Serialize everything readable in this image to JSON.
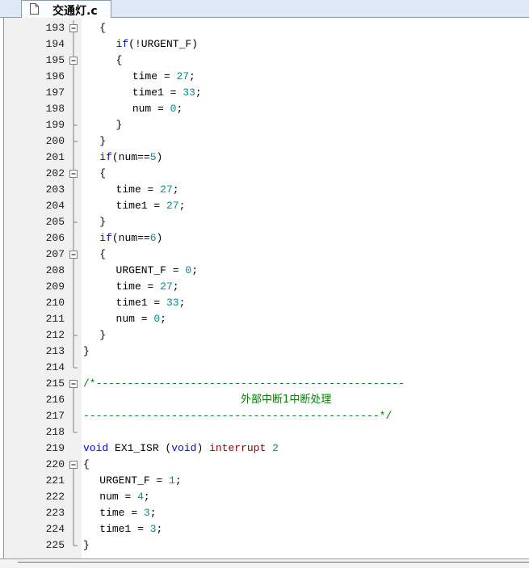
{
  "tab": {
    "label": "交通灯.c",
    "icon": "file-icon"
  },
  "lines": [
    {
      "n": "193",
      "fold": "box-cont",
      "indent": 2,
      "segs": [
        [
          "{",
          ""
        ]
      ]
    },
    {
      "n": "194",
      "fold": "line",
      "indent": 4,
      "segs": [
        [
          "if",
          "kw"
        ],
        [
          "(!URGENT_F)",
          ""
        ]
      ]
    },
    {
      "n": "195",
      "fold": "box-cont",
      "indent": 4,
      "segs": [
        [
          "{",
          ""
        ]
      ]
    },
    {
      "n": "196",
      "fold": "line",
      "indent": 6,
      "segs": [
        [
          "time = ",
          ""
        ],
        [
          "27",
          "num"
        ],
        [
          ";",
          ""
        ]
      ]
    },
    {
      "n": "197",
      "fold": "line",
      "indent": 6,
      "segs": [
        [
          "time1 = ",
          ""
        ],
        [
          "33",
          "num"
        ],
        [
          ";",
          ""
        ]
      ]
    },
    {
      "n": "198",
      "fold": "line",
      "indent": 6,
      "segs": [
        [
          "num = ",
          ""
        ],
        [
          "0",
          "num"
        ],
        [
          ";",
          ""
        ]
      ]
    },
    {
      "n": "199",
      "fold": "tee",
      "indent": 4,
      "segs": [
        [
          "}",
          ""
        ]
      ]
    },
    {
      "n": "200",
      "fold": "tee",
      "indent": 2,
      "segs": [
        [
          "}",
          ""
        ]
      ]
    },
    {
      "n": "201",
      "fold": "line",
      "indent": 2,
      "segs": [
        [
          "if",
          "kw"
        ],
        [
          "(num==",
          ""
        ],
        [
          "5",
          "num"
        ],
        [
          ")",
          ""
        ]
      ]
    },
    {
      "n": "202",
      "fold": "box-cont",
      "indent": 2,
      "segs": [
        [
          "{",
          ""
        ]
      ]
    },
    {
      "n": "203",
      "fold": "line",
      "indent": 4,
      "segs": [
        [
          "time = ",
          ""
        ],
        [
          "27",
          "num"
        ],
        [
          ";",
          ""
        ]
      ]
    },
    {
      "n": "204",
      "fold": "line",
      "indent": 4,
      "segs": [
        [
          "time1 = ",
          ""
        ],
        [
          "27",
          "num"
        ],
        [
          ";",
          ""
        ]
      ]
    },
    {
      "n": "205",
      "fold": "tee",
      "indent": 2,
      "segs": [
        [
          "}",
          ""
        ]
      ]
    },
    {
      "n": "206",
      "fold": "line",
      "indent": 2,
      "segs": [
        [
          "if",
          "kw"
        ],
        [
          "(num==",
          ""
        ],
        [
          "6",
          "num"
        ],
        [
          ")",
          ""
        ]
      ]
    },
    {
      "n": "207",
      "fold": "box-cont",
      "indent": 2,
      "segs": [
        [
          "{",
          ""
        ]
      ]
    },
    {
      "n": "208",
      "fold": "line",
      "indent": 4,
      "segs": [
        [
          "URGENT_F = ",
          ""
        ],
        [
          "0",
          "num"
        ],
        [
          ";",
          ""
        ]
      ]
    },
    {
      "n": "209",
      "fold": "line",
      "indent": 4,
      "segs": [
        [
          "time = ",
          ""
        ],
        [
          "27",
          "num"
        ],
        [
          ";",
          ""
        ]
      ]
    },
    {
      "n": "210",
      "fold": "line",
      "indent": 4,
      "segs": [
        [
          "time1 = ",
          ""
        ],
        [
          "33",
          "num"
        ],
        [
          ";",
          ""
        ]
      ]
    },
    {
      "n": "211",
      "fold": "line",
      "indent": 4,
      "segs": [
        [
          "num = ",
          ""
        ],
        [
          "0",
          "num"
        ],
        [
          ";",
          ""
        ]
      ]
    },
    {
      "n": "212",
      "fold": "tee",
      "indent": 2,
      "segs": [
        [
          "}",
          ""
        ]
      ]
    },
    {
      "n": "213",
      "fold": "line",
      "indent": 0,
      "segs": [
        [
          "}",
          ""
        ]
      ]
    },
    {
      "n": "214",
      "fold": "end",
      "indent": 0,
      "segs": []
    },
    {
      "n": "215",
      "fold": "box",
      "indent": 0,
      "segs": [
        [
          "/*-------------------------------------------------",
          "cmt"
        ]
      ]
    },
    {
      "n": "216",
      "fold": "line",
      "indent": 0,
      "segs": [
        [
          "                         ",
          ""
        ],
        [
          "外部中断1中断处理",
          "cjk"
        ]
      ]
    },
    {
      "n": "217",
      "fold": "line",
      "indent": 0,
      "segs": [
        [
          "-----------------------------------------------*/",
          "cmt"
        ]
      ]
    },
    {
      "n": "218",
      "fold": "end",
      "indent": 0,
      "segs": []
    },
    {
      "n": "219",
      "fold": "none",
      "indent": 0,
      "segs": [
        [
          "void",
          "kw"
        ],
        [
          " EX1_ISR (",
          ""
        ],
        [
          "void",
          "kw"
        ],
        [
          ") ",
          ""
        ],
        [
          "interrupt",
          "isr"
        ],
        [
          " ",
          ""
        ],
        [
          "2",
          "num"
        ]
      ]
    },
    {
      "n": "220",
      "fold": "box",
      "indent": 0,
      "segs": [
        [
          "{",
          ""
        ]
      ]
    },
    {
      "n": "221",
      "fold": "line",
      "indent": 2,
      "segs": [
        [
          "URGENT_F = ",
          ""
        ],
        [
          "1",
          "num"
        ],
        [
          ";",
          ""
        ]
      ]
    },
    {
      "n": "222",
      "fold": "line",
      "indent": 2,
      "segs": [
        [
          "num = ",
          ""
        ],
        [
          "4",
          "num"
        ],
        [
          ";",
          ""
        ]
      ]
    },
    {
      "n": "223",
      "fold": "line",
      "indent": 2,
      "segs": [
        [
          "time = ",
          ""
        ],
        [
          "3",
          "num"
        ],
        [
          ";",
          ""
        ]
      ]
    },
    {
      "n": "224",
      "fold": "line",
      "indent": 2,
      "segs": [
        [
          "time1 = ",
          ""
        ],
        [
          "3",
          "num"
        ],
        [
          ";",
          ""
        ]
      ]
    },
    {
      "n": "225",
      "fold": "end",
      "indent": 0,
      "segs": [
        [
          "}",
          ""
        ]
      ]
    }
  ]
}
